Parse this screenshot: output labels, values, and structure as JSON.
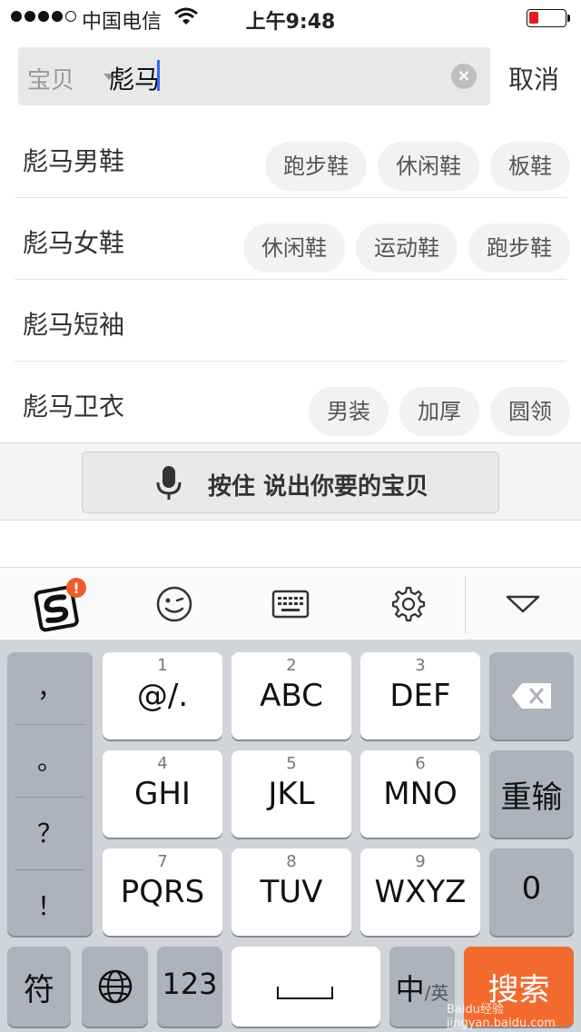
{
  "status_bar": {
    "carrier": "中国电信",
    "time": "上午9:48",
    "battery_level": 0.25,
    "signal_bars": 4
  },
  "search": {
    "scope": "宝贝",
    "query": "彪马",
    "cancel": "取消"
  },
  "suggestions": [
    {
      "title": "彪马男鞋",
      "chips": [
        "跑步鞋",
        "休闲鞋",
        "板鞋"
      ]
    },
    {
      "title": "彪马女鞋",
      "chips": [
        "休闲鞋",
        "运动鞋",
        "跑步鞋"
      ]
    },
    {
      "title": "彪马短袖",
      "chips": []
    },
    {
      "title": "彪马卫衣",
      "chips": [
        "男装",
        "加厚",
        "圆领"
      ]
    }
  ],
  "voice": {
    "label": "按住  说出你要的宝贝"
  },
  "keyboard": {
    "punctuation": [
      "，",
      "。",
      "？",
      "！"
    ],
    "keys": [
      {
        "num": "1",
        "letters": "@/."
      },
      {
        "num": "2",
        "letters": "ABC"
      },
      {
        "num": "3",
        "letters": "DEF"
      },
      {
        "num": "4",
        "letters": "GHI"
      },
      {
        "num": "5",
        "letters": "JKL"
      },
      {
        "num": "6",
        "letters": "MNO"
      },
      {
        "num": "7",
        "letters": "PQRS"
      },
      {
        "num": "8",
        "letters": "TUV"
      },
      {
        "num": "9",
        "letters": "WXYZ"
      }
    ],
    "retype": "重输",
    "zero": "0",
    "symbols": "符",
    "numbers": "123",
    "ime_main": "中",
    "ime_alt": "/英",
    "search_key": "搜索"
  },
  "colors": {
    "search_key": "#f26a2e",
    "badge": "#f05a28",
    "battery_low": "#e02020",
    "caret": "#3366ff"
  },
  "watermark": "Baidu经验 jingyan.baidu.com"
}
